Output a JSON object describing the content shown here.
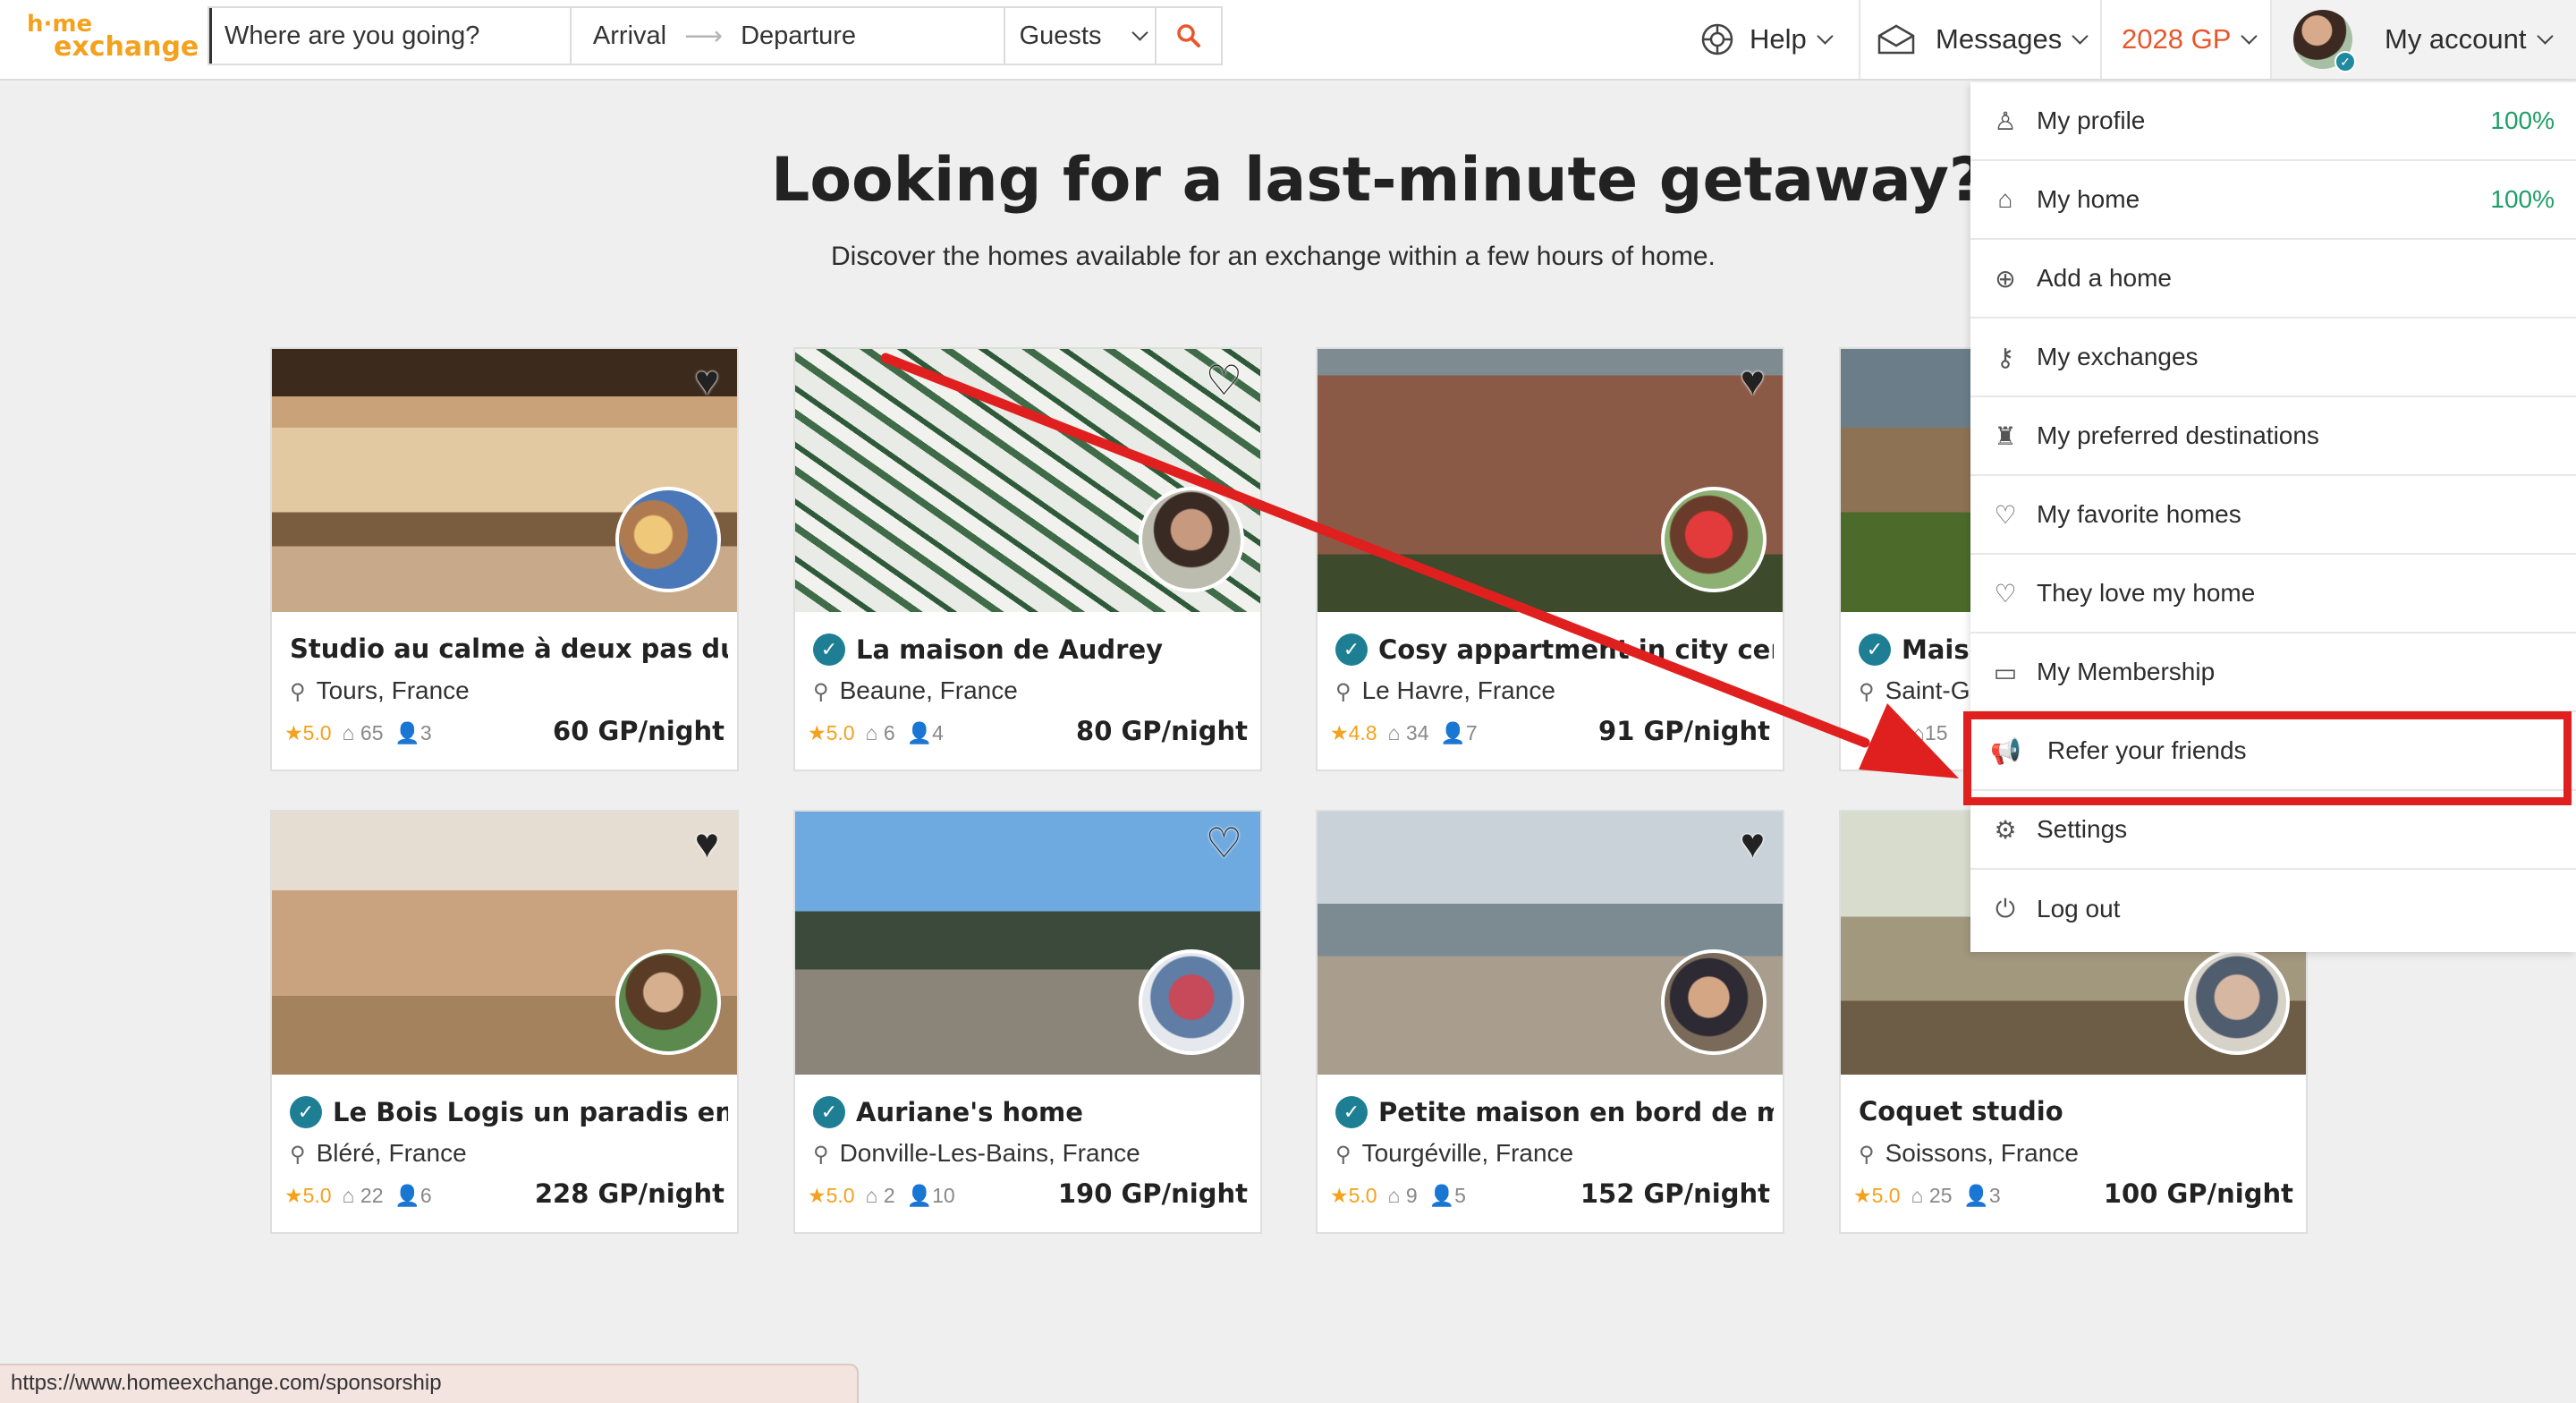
{
  "header": {
    "logo_top": "h·me",
    "logo_bottom": "exchange",
    "search": {
      "destination_placeholder": "Where are you going?",
      "arrival": "Arrival",
      "arrow": "⟶",
      "departure": "Departure",
      "guests": "Guests"
    },
    "help": "Help",
    "messages": "Messages",
    "points": "2028 GP",
    "account": "My account"
  },
  "hero": {
    "title": "Looking for a last-minute getaway?",
    "subtitle": "Discover the homes available for an exchange within a few hours of home."
  },
  "listings": [
    {
      "name": "Studio au calme à deux pas du …",
      "verified": false,
      "location": "Tours, France",
      "rating": "5.0",
      "reviews": "65",
      "guests": "3",
      "price": "60 GP/night"
    },
    {
      "name": "La maison de Audrey",
      "verified": true,
      "location": "Beaune, France",
      "rating": "5.0",
      "reviews": "6",
      "guests": "4",
      "price": "80 GP/night"
    },
    {
      "name": "Cosy appartment in city cen…",
      "verified": true,
      "location": "Le Havre, France",
      "rating": "4.8",
      "reviews": "34",
      "guests": "7",
      "price": "91 GP/night"
    },
    {
      "name": "Maiso",
      "verified": true,
      "location": "Saint-G",
      "rating": "",
      "reviews": "15",
      "guests": "",
      "price": ""
    },
    {
      "name": "Le Bois Logis un paradis en …",
      "verified": true,
      "location": "Bléré, France",
      "rating": "5.0",
      "reviews": "22",
      "guests": "6",
      "price": "228 GP/night"
    },
    {
      "name": "Auriane's home",
      "verified": true,
      "location": "Donville-Les-Bains, France",
      "rating": "5.0",
      "reviews": "2",
      "guests": "10",
      "price": "190 GP/night"
    },
    {
      "name": "Petite maison en bord de mer",
      "verified": true,
      "location": "Tourgéville, France",
      "rating": "5.0",
      "reviews": "9",
      "guests": "5",
      "price": "152 GP/night"
    },
    {
      "name": "Coquet studio",
      "verified": false,
      "location": "Soissons, France",
      "rating": "5.0",
      "reviews": "25",
      "guests": "3",
      "price": "100 GP/night"
    }
  ],
  "account_menu": [
    {
      "label": "My profile",
      "icon": "user-icon",
      "glyph": "♙",
      "pct": "100%"
    },
    {
      "label": "My home",
      "icon": "home-icon",
      "glyph": "⌂",
      "pct": "100%"
    },
    {
      "label": "Add a home",
      "icon": "plus-circle-icon",
      "glyph": "⊕",
      "pct": ""
    },
    {
      "label": "My exchanges",
      "icon": "keys-icon",
      "glyph": "⚷",
      "pct": ""
    },
    {
      "label": "My preferred destinations",
      "icon": "eiffel-tower-icon",
      "glyph": "♜",
      "pct": ""
    },
    {
      "label": "My favorite homes",
      "icon": "heart-icon",
      "glyph": "♡",
      "pct": ""
    },
    {
      "label": "They love my home",
      "icon": "heart-bubble-icon",
      "glyph": "♡",
      "pct": ""
    },
    {
      "label": "My Membership",
      "icon": "card-icon",
      "glyph": "▭",
      "pct": ""
    },
    {
      "label": "Refer your friends",
      "icon": "megaphone-icon",
      "glyph": "📢",
      "pct": ""
    },
    {
      "label": "Settings",
      "icon": "gear-icon",
      "glyph": "⚙",
      "pct": ""
    },
    {
      "label": "Log out",
      "icon": "power-icon",
      "glyph": "⏻",
      "pct": ""
    }
  ],
  "status_url": "https://www.homeexchange.com/sponsorship",
  "colors": {
    "brand": "#f4a11d",
    "accent": "#e8572b",
    "verified": "#1e7f94",
    "success": "#1f9e67",
    "annotation": "#e0201f"
  }
}
